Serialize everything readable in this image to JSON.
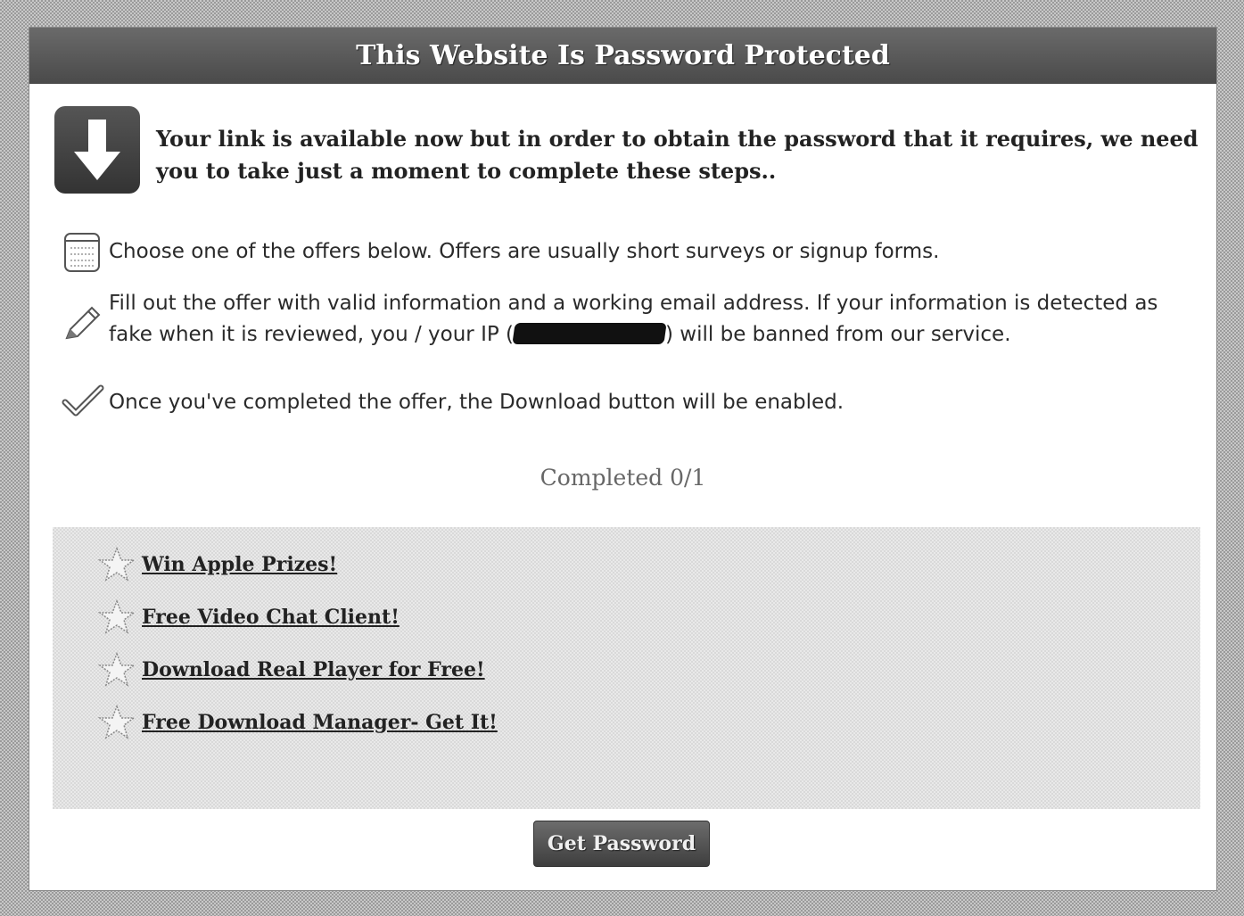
{
  "header": {
    "title": "This Website Is Password Protected"
  },
  "intro": {
    "icon": "download-arrow-icon",
    "text": "Your link is available now but in order to obtain the password that it requires, we need you to take just a moment to complete these steps.."
  },
  "steps": [
    {
      "icon": "notepad-icon",
      "text": "Choose one of the offers below. Offers are usually short surveys or signup forms."
    },
    {
      "icon": "pencil-icon",
      "text_before_ip": "Fill out the offer with valid information and a working email address. If your information is detected as fake when it is reviewed, you / your IP (",
      "text_after_ip": ") will be banned from our service."
    },
    {
      "icon": "checkmark-icon",
      "text": "Once you've completed the offer, the Download button will be enabled."
    }
  ],
  "progress": {
    "text": "Completed 0/1",
    "completed": 0,
    "total": 1
  },
  "offers": [
    {
      "icon": "star-icon",
      "label": "Win Apple Prizes!"
    },
    {
      "icon": "star-icon",
      "label": "Free Video Chat Client!"
    },
    {
      "icon": "star-icon",
      "label": "Download Real Player for Free!"
    },
    {
      "icon": "star-icon",
      "label": "Free Download Manager- Get It!"
    }
  ],
  "button": {
    "label": "Get Password"
  }
}
